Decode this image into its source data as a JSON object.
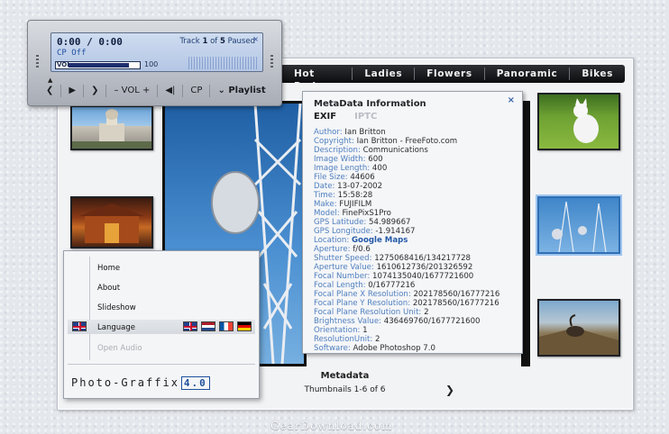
{
  "navbar": {
    "items": [
      {
        "label": "Hot Rods"
      },
      {
        "label": "Ladies"
      },
      {
        "label": "Flowers"
      },
      {
        "label": "Panoramic"
      },
      {
        "label": "Bikes"
      }
    ]
  },
  "player": {
    "time": "0:00 / 0:00",
    "track_label": "Track",
    "track_num": "1",
    "of_label": "of",
    "track_total": "5",
    "status": "Paused",
    "cp_status": "CP  Off",
    "vol_label": "VOL",
    "volume_value": "100",
    "volume_fraction": 0.86,
    "close_glyph": "×",
    "eject_glyph": "▲",
    "controls": {
      "prev": "❮",
      "play": "▶",
      "next": "❯",
      "vol_minus": "–",
      "vol_text": "VOL",
      "vol_plus": "+",
      "mute": "◀|",
      "cp": "CP",
      "playlist_arrow": "⌄",
      "playlist": "Playlist"
    }
  },
  "metadata_panel": {
    "title": "MetaData Information",
    "close_glyph": "×",
    "tabs": [
      {
        "label": "EXIF"
      },
      {
        "label": "IPTC"
      }
    ],
    "fields": [
      {
        "key": "Author:",
        "value": "Ian Britton"
      },
      {
        "key": "Copyright:",
        "value": "Ian Britton - FreeFoto.com"
      },
      {
        "key": "Description:",
        "value": "Communications"
      },
      {
        "key": "Image Width:",
        "value": "600"
      },
      {
        "key": "Image Length:",
        "value": "400"
      },
      {
        "key": "File Size:",
        "value": "44606"
      },
      {
        "key": "Date:",
        "value": "13-07-2002"
      },
      {
        "key": "Time:",
        "value": "15:58:28"
      },
      {
        "key": "Make:",
        "value": "FUJIFILM"
      },
      {
        "key": "Model:",
        "value": "FinePixS1Pro"
      },
      {
        "key": "GPS Latitude:",
        "value": "54.989667"
      },
      {
        "key": "GPS Longitude:",
        "value": "-1.914167"
      },
      {
        "key": "Location:",
        "value": "Google Maps"
      },
      {
        "key": "Aperture:",
        "value": "f/0.6"
      },
      {
        "key": "Shutter Speed:",
        "value": "1275068416/134217728"
      },
      {
        "key": "Aperture Value:",
        "value": "1610612736/201326592"
      },
      {
        "key": "Focal Number:",
        "value": "1074135040/1677721600"
      },
      {
        "key": "Focal Length:",
        "value": "0/16777216"
      },
      {
        "key": "Focal Plane X Resolution:",
        "value": "202178560/16777216"
      },
      {
        "key": "Focal Plane Y Resolution:",
        "value": "202178560/16777216"
      },
      {
        "key": "Focal Plane Resolution Unit:",
        "value": "2"
      },
      {
        "key": "Brightness Value:",
        "value": "436469760/1677721600"
      },
      {
        "key": "Orientation:",
        "value": "1"
      },
      {
        "key": "ResolutionUnit:",
        "value": "2"
      },
      {
        "key": "Software:",
        "value": "Adobe Photoshop 7.0"
      }
    ]
  },
  "caption": {
    "title": "Metadata",
    "count": "Thumbnails 1-6 of 6",
    "next_glyph": "❯"
  },
  "menu": {
    "items": [
      {
        "label": "Home"
      },
      {
        "label": "About"
      },
      {
        "label": "Slideshow"
      },
      {
        "label": "Language"
      },
      {
        "label": "Open Audio"
      }
    ],
    "logo_text": "Photo-Graffix",
    "logo_version": "4.0"
  },
  "watermark": "GearDownload.com"
}
